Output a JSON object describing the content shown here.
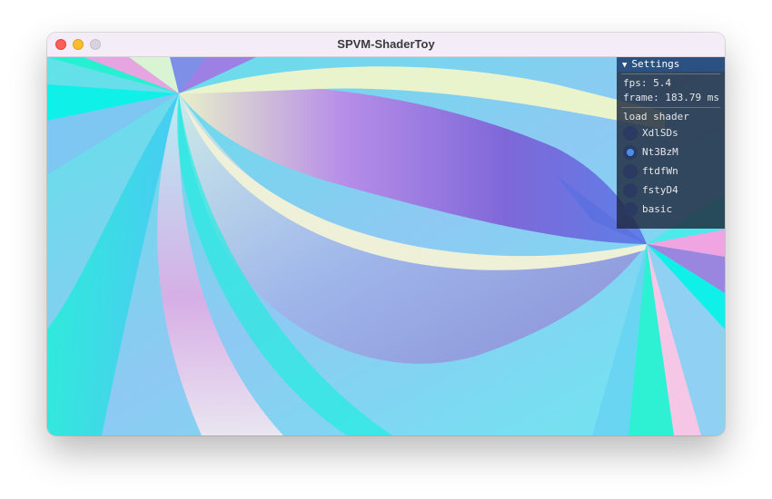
{
  "window": {
    "title": "SPVM-ShaderToy"
  },
  "settings": {
    "header": "Settings",
    "fps": "fps: 5.4",
    "frame": "frame: 183.79 ms",
    "load_label": "load shader",
    "options": [
      {
        "label": "XdlSDs",
        "selected": false
      },
      {
        "label": "Nt3BzM",
        "selected": true
      },
      {
        "label": "ftdfWn",
        "selected": false
      },
      {
        "label": "fstyD4",
        "selected": false
      },
      {
        "label": "basic",
        "selected": false
      }
    ]
  }
}
